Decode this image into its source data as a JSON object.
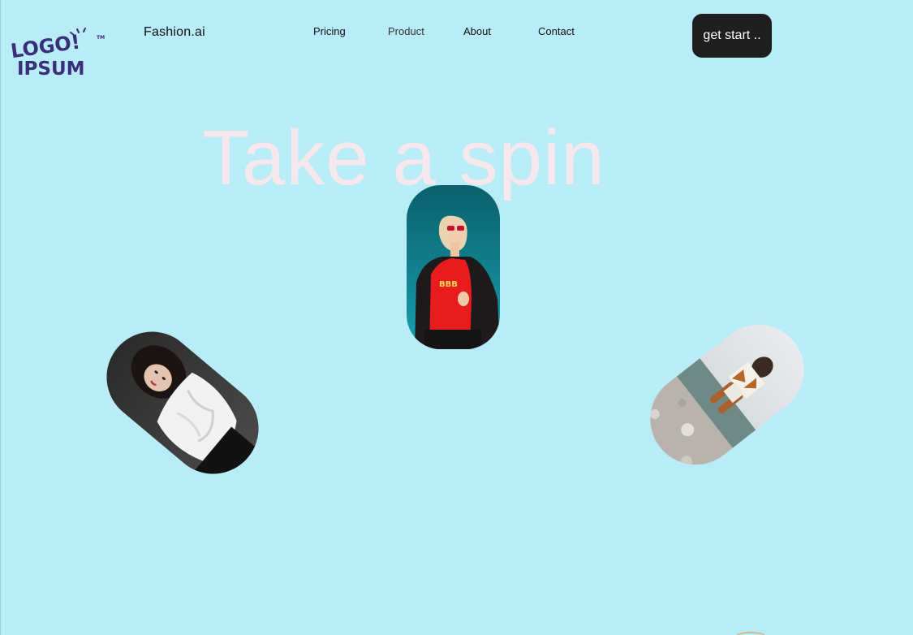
{
  "logo": {
    "line1": "LOGO!",
    "line2": "IPSUM",
    "tm": "TM",
    "color": "#3a2e7a"
  },
  "header": {
    "brand": "Fashion.ai",
    "nav": [
      {
        "label": "Pricing"
      },
      {
        "label": "Product"
      },
      {
        "label": "About"
      },
      {
        "label": "Contact"
      }
    ],
    "cta_label": "get start .."
  },
  "hero": {
    "title": "Take a spin"
  },
  "gallery": {
    "photos": [
      {
        "name": "center-photo",
        "subject": "woman-red-shirt-sunglasses",
        "bg": "#0c7f8e"
      },
      {
        "name": "left-photo",
        "subject": "woman-white-ruffle-top",
        "bg": "#3c3c3c"
      },
      {
        "name": "right-photo",
        "subject": "woman-brown-boots-beach",
        "bg": "#d9dcde"
      }
    ]
  },
  "colors": {
    "background": "#b8ecf7",
    "title": "#f7e8ee",
    "cta_bg": "#1f1f1f"
  }
}
